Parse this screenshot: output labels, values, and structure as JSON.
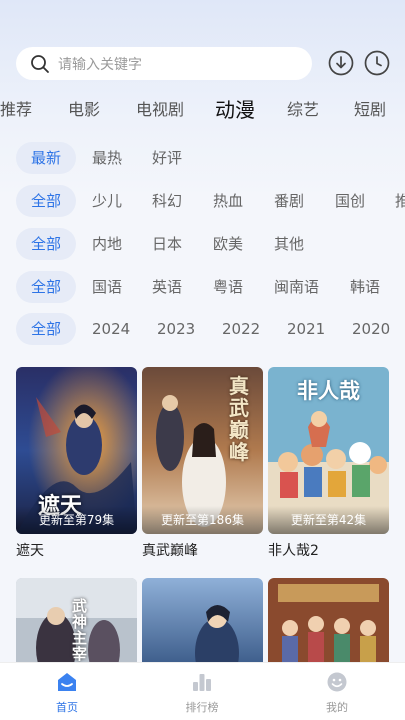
{
  "search": {
    "placeholder": "请输入关键字"
  },
  "category_tabs": [
    {
      "label": "推荐"
    },
    {
      "label": "电影"
    },
    {
      "label": "电视剧"
    },
    {
      "label": "动漫",
      "active": true
    },
    {
      "label": "综艺"
    },
    {
      "label": "短剧"
    }
  ],
  "filters": {
    "sort": [
      "最新",
      "最热",
      "好评"
    ],
    "genre": [
      "全部",
      "少儿",
      "科幻",
      "热血",
      "番剧",
      "国创",
      "推"
    ],
    "region": [
      "全部",
      "内地",
      "日本",
      "欧美",
      "其他"
    ],
    "language": [
      "全部",
      "国语",
      "英语",
      "粤语",
      "闽南语",
      "韩语"
    ],
    "year": [
      "全部",
      "2024",
      "2023",
      "2022",
      "2021",
      "2020"
    ]
  },
  "items": [
    {
      "title": "遮天",
      "episode": "更新至第79集",
      "poster_text": "遮天"
    },
    {
      "title": "真武巅峰",
      "episode": "更新至第186集",
      "poster_text": "真武巅峰"
    },
    {
      "title": "非人哉2",
      "episode": "更新至第42集",
      "poster_text": "非人哉"
    },
    {
      "title": "",
      "episode": "",
      "poster_text": "武神主宰"
    },
    {
      "title": "",
      "episode": "",
      "poster_text": ""
    },
    {
      "title": "",
      "episode": "",
      "poster_text": ""
    }
  ],
  "bottom_nav": [
    {
      "label": "首页",
      "icon": "home-icon",
      "active": true
    },
    {
      "label": "排行榜",
      "icon": "ranking-icon"
    },
    {
      "label": "我的",
      "icon": "profile-icon"
    }
  ],
  "colors": {
    "accent": "#2e74e6",
    "chip_bg": "#e6ebf7"
  }
}
